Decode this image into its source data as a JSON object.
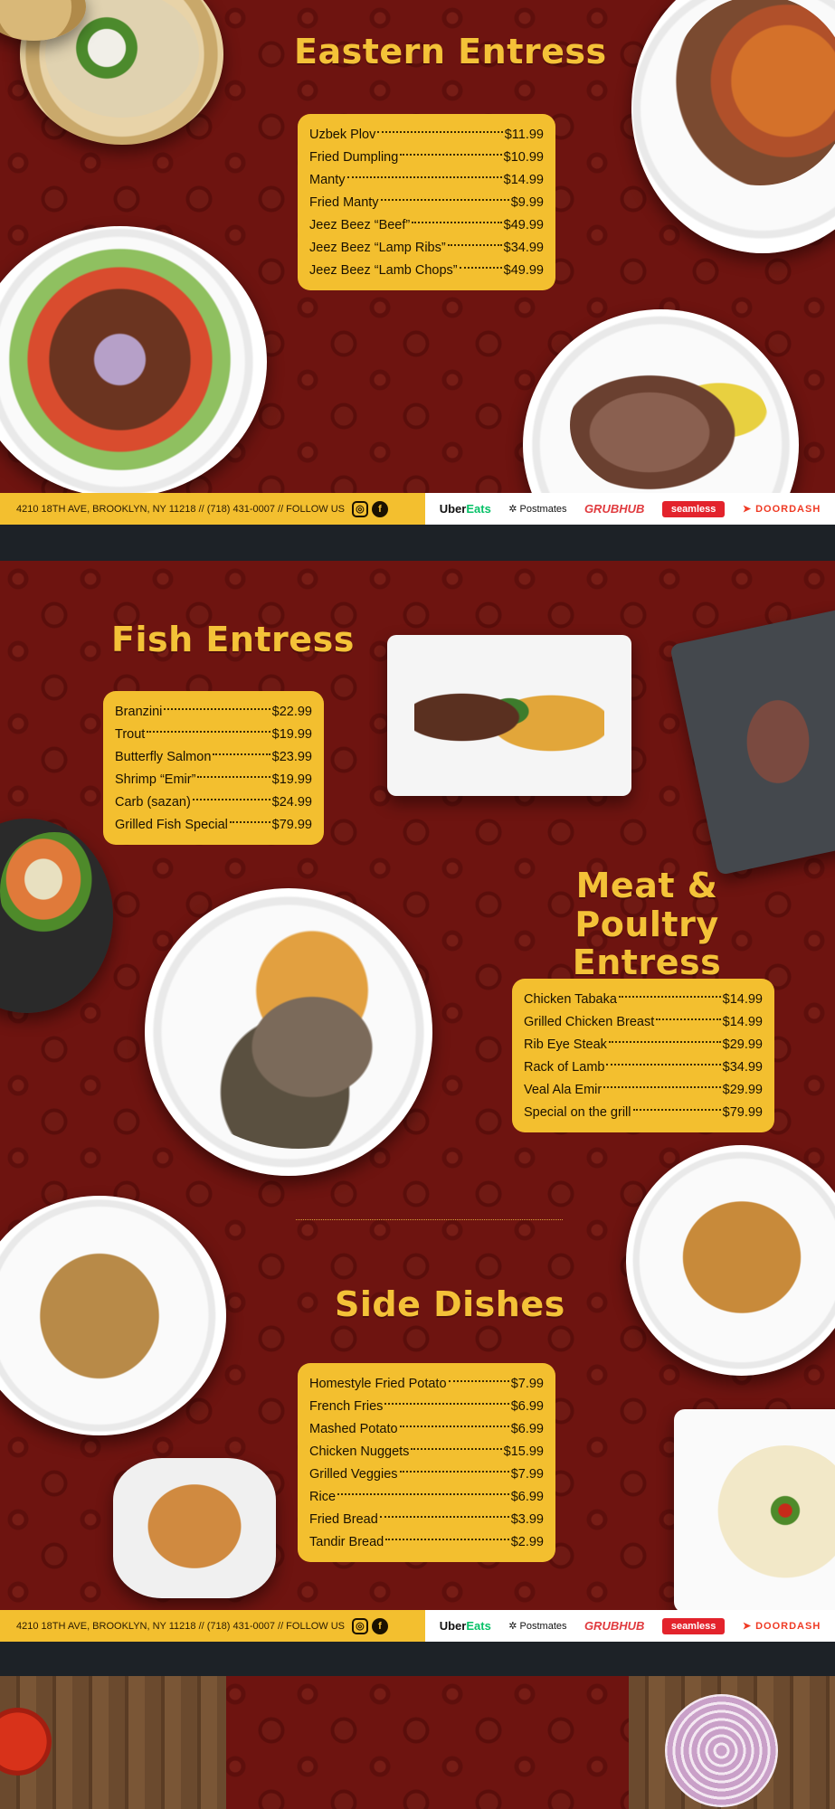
{
  "eastern": {
    "title": "Eastern Entress",
    "items": [
      {
        "name": "Uzbek Plov",
        "price": "$11.99"
      },
      {
        "name": "Fried Dumpling",
        "price": "$10.99"
      },
      {
        "name": "Manty",
        "price": "$14.99"
      },
      {
        "name": "Fried Manty",
        "price": "$9.99"
      },
      {
        "name": "Jeez Beez “Beef”",
        "price": "$49.99"
      },
      {
        "name": "Jeez Beez “Lamp Ribs”",
        "price": "$34.99"
      },
      {
        "name": "Jeez Beez “Lamb Chops”",
        "price": "$49.99"
      }
    ]
  },
  "fish": {
    "title": "Fish Entress",
    "items": [
      {
        "name": "Branzini",
        "price": "$22.99"
      },
      {
        "name": "Trout",
        "price": "$19.99"
      },
      {
        "name": "Butterfly Salmon",
        "price": "$23.99"
      },
      {
        "name": "Shrimp “Emir”",
        "price": "$19.99"
      },
      {
        "name": "Carb (sazan)",
        "price": "$24.99"
      },
      {
        "name": "Grilled Fish Special",
        "price": "$79.99"
      }
    ]
  },
  "meat": {
    "title_line1": "Meat &",
    "title_line2": "Poultry Entress",
    "items": [
      {
        "name": "Chicken Tabaka",
        "price": "$14.99"
      },
      {
        "name": "Grilled Chicken Breast",
        "price": "$14.99"
      },
      {
        "name": "Rib Eye Steak",
        "price": "$29.99"
      },
      {
        "name": "Rack of Lamb",
        "price": "$34.99"
      },
      {
        "name": "Veal Ala Emir",
        "price": "$29.99"
      },
      {
        "name": "Special on the grill",
        "price": "$79.99"
      }
    ]
  },
  "sides": {
    "title": "Side Dishes",
    "items": [
      {
        "name": "Homestyle Fried Potato",
        "price": "$7.99"
      },
      {
        "name": "French Fries",
        "price": "$6.99"
      },
      {
        "name": "Mashed Potato",
        "price": "$6.99"
      },
      {
        "name": "Chicken Nuggets",
        "price": "$15.99"
      },
      {
        "name": "Grilled Veggies",
        "price": "$7.99"
      },
      {
        "name": "Rice",
        "price": "$6.99"
      },
      {
        "name": "Fried Bread",
        "price": "$3.99"
      },
      {
        "name": "Tandir Bread",
        "price": "$2.99"
      }
    ]
  },
  "footer": {
    "contact": "4210 18TH AVE, BROOKLYN, NY 11218 // (718) 431-0007 // FOLLOW US",
    "instagram_icon": "instagram-icon",
    "facebook_icon": "facebook-icon",
    "uber_a": "Uber",
    "uber_b": "Eats",
    "postmates": "Postmates",
    "grubhub": "GRUBHUB",
    "seamless": "seamless",
    "doordash": "DOORDASH"
  },
  "colors": {
    "background": "#6e1410",
    "accent": "#f3bf2f",
    "band": "#1d2227"
  }
}
